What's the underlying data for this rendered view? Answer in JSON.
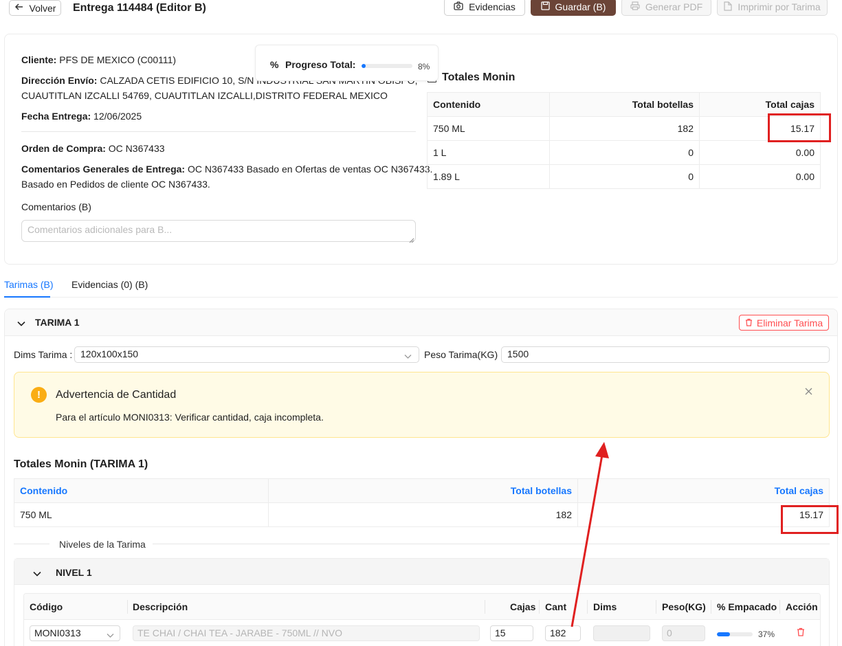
{
  "header": {
    "back_label": "Volver",
    "title": "Entrega 114484 (Editor B)",
    "evidence_label": "Evidencias",
    "save_label": "Guardar (B)",
    "pdf_label": "Generar PDF",
    "print_label": "Imprimir por Tarima"
  },
  "info": {
    "cliente_label": "Cliente:",
    "cliente_value": "PFS DE MEXICO (C00111)",
    "direccion_label": "Dirección Envío:",
    "direccion_value_1": "CALZADA CETIS EDIFICIO 10, S/N INDUSTRIAL SAN MARTIN OBISPO,",
    "direccion_value_2": "CUAUTITLAN IZCALLI 54769, CUAUTITLAN IZCALLI,DISTRITO FEDERAL MEXICO",
    "fecha_label": "Fecha Entrega:",
    "fecha_value": "12/06/2025",
    "orden_label": "Orden de Compra:",
    "orden_value": "OC N367433",
    "comentarios_label": "Comentarios Generales de Entrega:",
    "comentarios_value_1": "OC N367433 Basado en Ofertas de ventas OC N367433.",
    "comentarios_value_2": "Basado en Pedidos de cliente OC N367433.",
    "comentarios_b_label": "Comentarios (B)",
    "comentarios_b_placeholder": "Comentarios adicionales para B..."
  },
  "progress": {
    "label": "Progreso Total:",
    "percent_text": "8%",
    "fraction": 0.08
  },
  "totals": {
    "title": "Totales Monin",
    "headers": [
      "Contenido",
      "Total botellas",
      "Total cajas"
    ],
    "rows": [
      [
        "750 ML",
        "182",
        "15.17"
      ],
      [
        "1 L",
        "0",
        "0.00"
      ],
      [
        "1.89 L",
        "0",
        "0.00"
      ]
    ]
  },
  "tabs": {
    "tab1": "Tarimas (B)",
    "tab2": "Evidencias (0) (B)"
  },
  "pallet": {
    "title": "TARIMA 1",
    "delete_label": "Eliminar Tarima",
    "dims_label": "Dims Tarima",
    "dims_value": "120x100x150",
    "peso_label": "Peso Tarima(KG)",
    "peso_value": "1500",
    "alert_title": "Advertencia de Cantidad",
    "alert_text": "Para el artículo MONI0313: Verificar cantidad, caja incompleta.",
    "totals_title": "Totales Monin (TARIMA 1)",
    "totals_headers": [
      "Contenido",
      "Total botellas",
      "Total cajas"
    ],
    "totals_row": [
      "750 ML",
      "182",
      "15.17"
    ],
    "levels_label": "Niveles de la Tarima"
  },
  "level": {
    "title": "NIVEL 1",
    "headers": [
      "Código",
      "Descripción",
      "Cajas",
      "Cant",
      "Dims",
      "Peso(KG)",
      "% Empacado",
      "Acción"
    ],
    "row": {
      "code": "MONI0313",
      "description": "TE CHAI / CHAI TEA - JARABE - 750ML // NVO",
      "cajas": "15",
      "cant": "182",
      "dims": "",
      "peso": "0",
      "empacado_text": "37%",
      "empacado_fraction": 0.37
    }
  },
  "colors": {
    "accent": "#1677ff",
    "brand_button": "#6b4437",
    "danger": "#e02020",
    "warning_bg": "#fffbe6"
  }
}
